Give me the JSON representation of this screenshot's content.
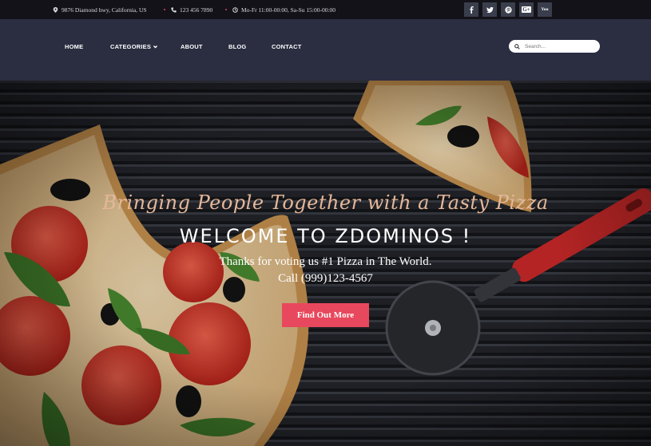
{
  "topbar": {
    "address": "9876 Diamond hwy, California, US",
    "phone": "123 456 7890",
    "hours": "Mo-Fr 11:00-00:00, Sa-Su 15:00-00:00",
    "address_icon": "map-pin-icon",
    "phone_icon": "phone-icon",
    "hours_icon": "clock-icon",
    "social": [
      "facebook-icon",
      "twitter-icon",
      "pinterest-icon",
      "google-plus-icon",
      "youtube-icon"
    ],
    "social_labels": {
      "googleplus": "G+",
      "youtube": "You"
    }
  },
  "nav": {
    "items": [
      "HOME",
      "CATEGORIES",
      "ABOUT",
      "BLOG",
      "CONTACT"
    ],
    "search_placeholder": "Search..."
  },
  "hero": {
    "tagline": "Bringing People Together with a Tasty Pizza",
    "headline": "WELCOME TO ZDOMINOS !",
    "subline": "Thanks for voting us #1 Pizza in The World.",
    "phone": "Call (999)123-4567",
    "cta": "Find Out More"
  },
  "colors": {
    "topbar_bg": "#121218",
    "nav_bg": "#2b2d40",
    "accent": "#e8485d",
    "tagline": "#e4b79a"
  }
}
